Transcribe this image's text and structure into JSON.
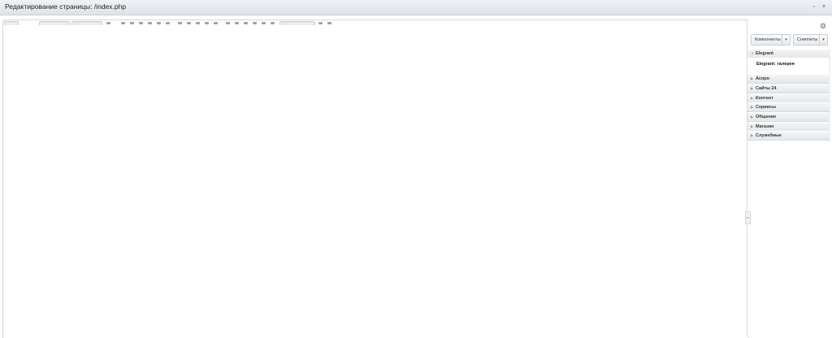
{
  "window": {
    "title": "Редактирование страницы: /index.php",
    "restore_icon": "▫",
    "close_icon": "×"
  },
  "sidebar": {
    "settings_icon": "⚙",
    "components_label": "Компоненты",
    "snippets_label": "Сниппеты",
    "dropdown_arrow": "▾",
    "expanded_section": {
      "label": "Elegrant",
      "items": [
        "Elegrant: галерея"
      ]
    },
    "sections": [
      "Аспро",
      "Сайты 24",
      "Контент",
      "Сервисы",
      "Общение",
      "Магазин",
      "Служебные"
    ],
    "collapse_icon": "▸"
  }
}
